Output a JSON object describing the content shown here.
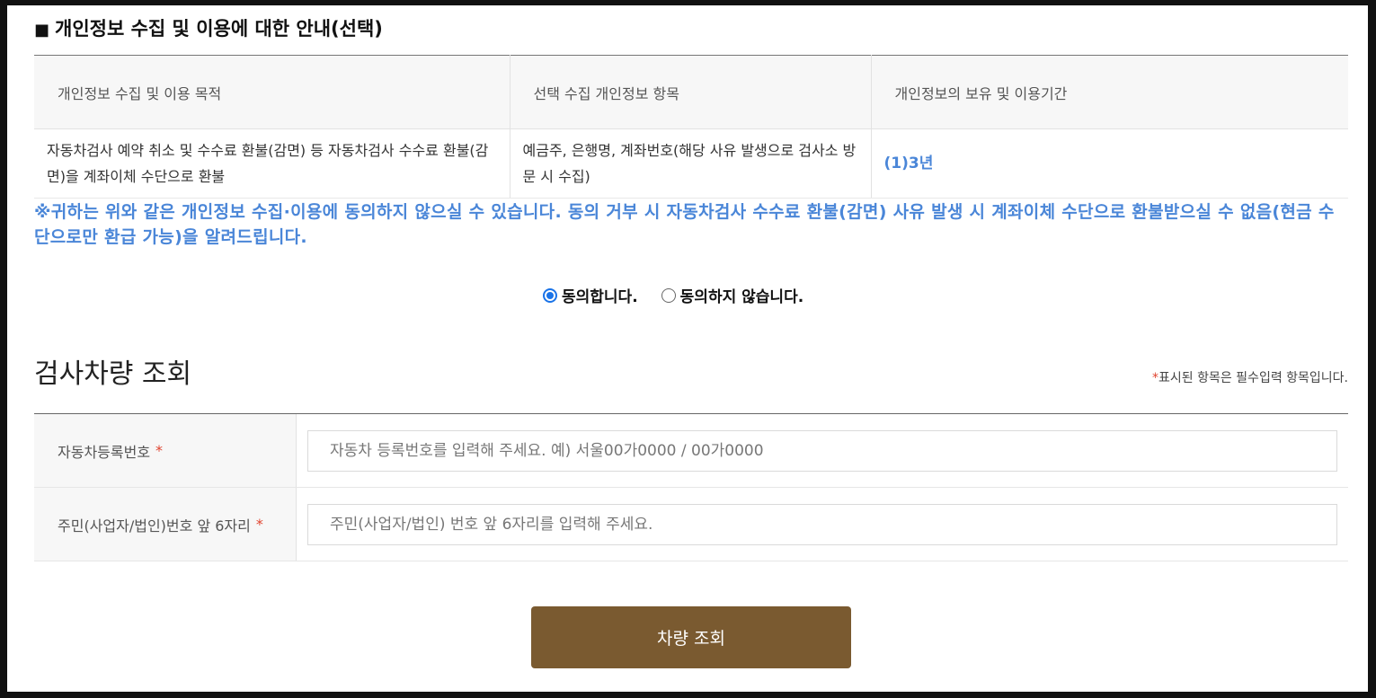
{
  "section": {
    "marker": "■",
    "title": "개인정보 수집 및 이용에 대한 안내(선택)"
  },
  "info_table": {
    "headers": [
      "개인정보 수집 및 이용 목적",
      "선택 수집 개인정보 항목",
      "개인정보의 보유 및 이용기간"
    ],
    "row": {
      "purpose": "자동차검사 예약 취소 및 수수료 환불(감면) 등 자동차검사 수수료 환불(감면)을 계좌이체 수단으로 환불",
      "items": "예금주, 은행명, 계좌번호(해당 사유 발생으로 검사소 방문 시 수집)",
      "period": "(1)3년"
    }
  },
  "notice": "※귀하는 위와 같은 개인정보 수집·이용에 동의하지 않으실 수 있습니다. 동의 거부 시 자동차검사 수수료 환불(감면) 사유 발생 시 계좌이체 수단으로 환불받으실 수 없음(현금 수단으로만 환급 가능)을 알려드립니다.",
  "consent": {
    "agree": "동의합니다.",
    "disagree": "동의하지 않습니다.",
    "selected": "agree"
  },
  "search": {
    "title": "검사차량 조회",
    "required_star": "*",
    "required_note": "표시된 항목은 필수입력 항목입니다.",
    "fields": [
      {
        "label": "자동차등록번호",
        "star": "*",
        "placeholder": "자동차 등록번호를 입력해 주세요. 예) 서울00가0000 / 00가0000",
        "value": ""
      },
      {
        "label": "주민(사업자/법인)번호 앞 6자리",
        "star": "*",
        "placeholder": "주민(사업자/법인) 번호 앞 6자리를 입력해 주세요.",
        "value": ""
      }
    ],
    "submit_label": "차량 조회"
  },
  "colors": {
    "notice_blue": "#4a86d8",
    "button_brown": "#7a5a30",
    "required_red": "#e0442f",
    "radio_blue": "#1a73e8"
  }
}
